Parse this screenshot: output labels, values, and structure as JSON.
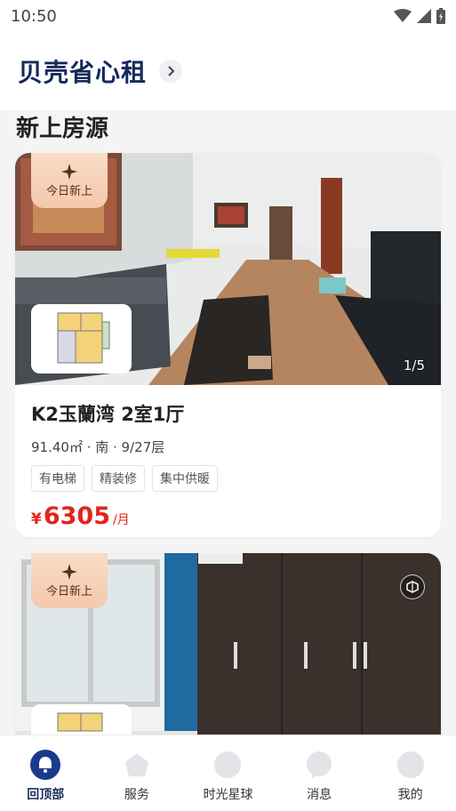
{
  "status_bar": {
    "time": "10:50"
  },
  "header": {
    "title": "贝壳省心租"
  },
  "section": {
    "title": "新上房源"
  },
  "listings": [
    {
      "badge": "今日新上",
      "photo_counter": "1/5",
      "title": "K2玉蘭湾 2室1厅",
      "meta": "91.40㎡ · 南 · 9/27层",
      "tags": [
        "有电梯",
        "精装修",
        "集中供暖"
      ],
      "price_currency": "¥",
      "price": "6305",
      "price_unit": "/月"
    },
    {
      "badge": "今日新上"
    }
  ],
  "bottom_nav": [
    {
      "label": "回顶部",
      "icon": "back-to-top-icon",
      "active": true
    },
    {
      "label": "服务",
      "icon": "service-icon",
      "active": false
    },
    {
      "label": "时光星球",
      "icon": "planet-icon",
      "active": false
    },
    {
      "label": "消息",
      "icon": "message-icon",
      "active": false
    },
    {
      "label": "我的",
      "icon": "profile-icon",
      "active": false
    }
  ],
  "colors": {
    "brand": "#142a5c",
    "price": "#e1251b",
    "badge": "#f3c9ad"
  }
}
